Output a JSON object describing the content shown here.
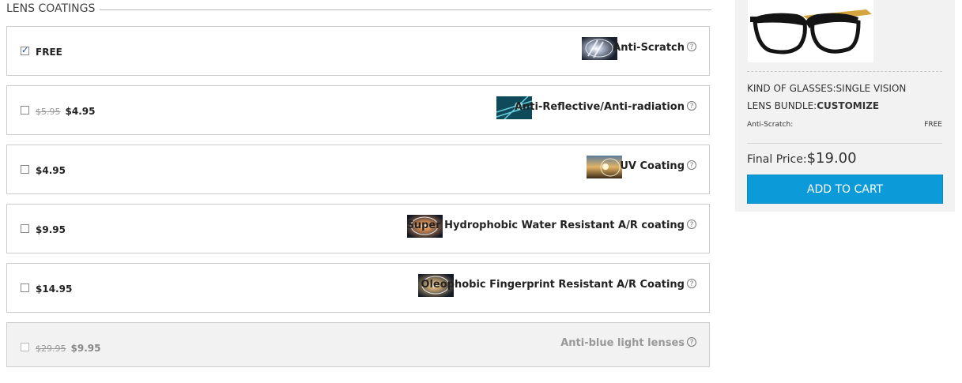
{
  "section": {
    "title": "LENS COATINGS"
  },
  "options": [
    {
      "checked": true,
      "old_price": "",
      "price": "FREE",
      "name": "Anti-Scratch",
      "icon": "anti-scratch-thumb"
    },
    {
      "checked": false,
      "old_price": "$5.95",
      "price": "$4.95",
      "name": "Anti-Reflective/Anti-radiation",
      "icon": "anti-reflective-thumb"
    },
    {
      "checked": false,
      "old_price": "",
      "price": "$4.95",
      "name": "UV Coating",
      "icon": "uv-coating-thumb"
    },
    {
      "checked": false,
      "old_price": "",
      "price": "$9.95",
      "name": "Super Hydrophobic Water Resistant A/R coating",
      "icon": "hydrophobic-thumb"
    },
    {
      "checked": false,
      "old_price": "",
      "price": "$14.95",
      "name": "Oleophobic Fingerprint Resistant A/R Coating",
      "icon": "oleophobic-thumb"
    },
    {
      "checked": false,
      "old_price": "$29.95",
      "price": "$9.95",
      "name": "Anti-blue light lenses",
      "disabled": true
    }
  ],
  "help_glyph": "?",
  "summary": {
    "kind_label": "KIND OF GLASSES:",
    "kind_value": "SINGLE VISION",
    "bundle_label": "LENS BUNDLE:",
    "bundle_value": "CUSTOMIZE",
    "line_item_label": "Anti-Scratch:",
    "line_item_value": "FREE",
    "final_label": "Final Price:",
    "final_value": "$19.00",
    "add_to_cart": "ADD TO CART"
  },
  "colors": {
    "button": "#0c9bd8",
    "panel_bg": "#f2f2f2",
    "frame_temple": "#d4a441"
  }
}
